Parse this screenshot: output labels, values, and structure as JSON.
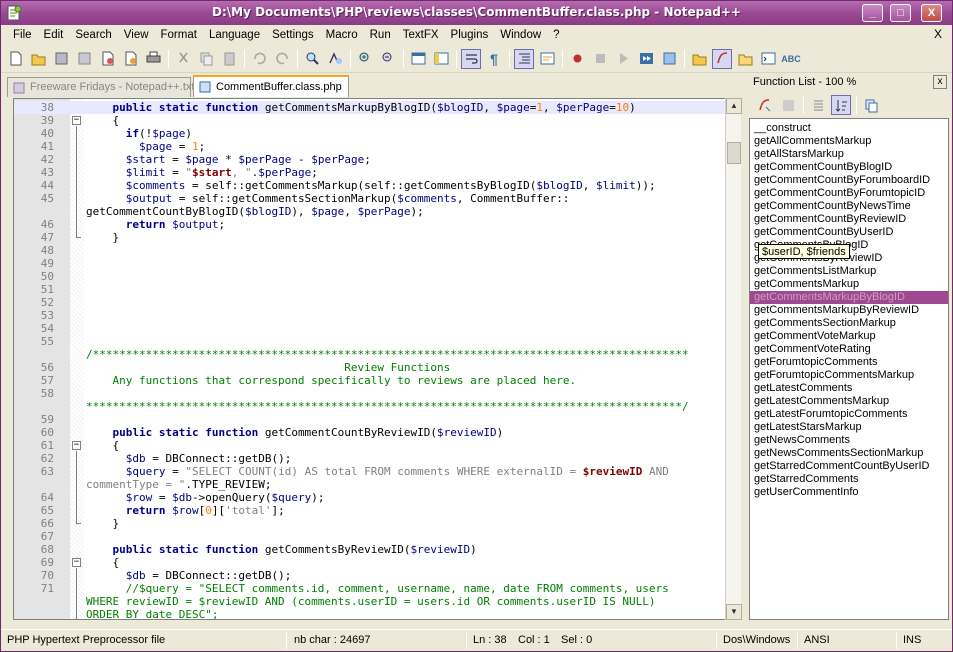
{
  "window": {
    "title": "D:\\My Documents\\PHP\\reviews\\classes\\CommentBuffer.class.php - Notepad++",
    "min": "_",
    "max": "□",
    "close": "X"
  },
  "menu": [
    "File",
    "Edit",
    "Search",
    "View",
    "Format",
    "Language",
    "Settings",
    "Macro",
    "Run",
    "TextFX",
    "Plugins",
    "Window",
    "?"
  ],
  "menu_close": "X",
  "tabs": [
    {
      "label": "Freeware Fridays - Notepad++.txt",
      "active": false
    },
    {
      "label": "CommentBuffer.class.php",
      "active": true
    }
  ],
  "code_lines": [
    {
      "n": "38",
      "fold": "",
      "hl": true,
      "html": "    <span class='kw'>public static function</span> getCommentsMarkupByBlogID(<span class='var'>$blogID</span>, <span class='var'>$page</span>=<span class='num-c'>1</span>, <span class='var'>$perPage</span>=<span class='num-c'>10</span>)"
    },
    {
      "n": "39",
      "fold": "box",
      "html": "    {"
    },
    {
      "n": "40",
      "fold": "",
      "html": "      <span class='kw'>if</span>(!<span class='var'>$page</span>)"
    },
    {
      "n": "41",
      "fold": "",
      "html": "        <span class='var'>$page</span> = <span class='num-c'>1</span>;"
    },
    {
      "n": "42",
      "fold": "",
      "html": "      <span class='var'>$start</span> = <span class='var'>$page</span> * <span class='var'>$perPage</span> - <span class='var'>$perPage</span>;"
    },
    {
      "n": "43",
      "fold": "",
      "html": "      <span class='var'>$limit</span> = <span class='str'>\"</span><span class='strv'>$start</span><span class='str'>, \"</span>.<span class='var'>$perPage</span>;"
    },
    {
      "n": "44",
      "fold": "",
      "html": "      <span class='var'>$comments</span> = self::getCommentsMarkup(self::getCommentsByBlogID(<span class='var'>$blogID</span>, <span class='var'>$limit</span>));"
    },
    {
      "n": "45",
      "fold": "",
      "html": "      <span class='var'>$output</span> = self::getCommentsSectionMarkup(<span class='var'>$comments</span>, CommentBuffer::"
    },
    {
      "n": "",
      "fold": "",
      "wrap": true,
      "html": "getCommentCountByBlogID(<span class='var'>$blogID</span>), <span class='var'>$page</span>, <span class='var'>$perPage</span>);"
    },
    {
      "n": "46",
      "fold": "",
      "html": "      <span class='kw'>return</span> <span class='var'>$output</span>;"
    },
    {
      "n": "47",
      "fold": "end",
      "html": "    }"
    },
    {
      "n": "48",
      "fold": "",
      "html": ""
    },
    {
      "n": "49",
      "fold": "",
      "html": ""
    },
    {
      "n": "50",
      "fold": "",
      "html": ""
    },
    {
      "n": "51",
      "fold": "",
      "html": ""
    },
    {
      "n": "52",
      "fold": "",
      "html": ""
    },
    {
      "n": "53",
      "fold": "",
      "html": ""
    },
    {
      "n": "54",
      "fold": "",
      "html": ""
    },
    {
      "n": "55",
      "fold": "",
      "html": ""
    },
    {
      "n": "",
      "fold": "",
      "wrap": true,
      "html": "<span class='cmt'>/******************************************************************************************</span>"
    },
    {
      "n": "56",
      "fold": "",
      "html": "<span class='cmt'>                                       Review Functions</span>"
    },
    {
      "n": "57",
      "fold": "",
      "html": "<span class='cmt'>    Any functions that correspond specifically to reviews are placed here.</span>"
    },
    {
      "n": "58",
      "fold": "",
      "html": ""
    },
    {
      "n": "",
      "fold": "",
      "wrap": true,
      "html": "<span class='cmt'>******************************************************************************************/</span>"
    },
    {
      "n": "59",
      "fold": "",
      "html": ""
    },
    {
      "n": "60",
      "fold": "",
      "html": "    <span class='kw'>public static function</span> getCommentCountByReviewID(<span class='var'>$reviewID</span>)"
    },
    {
      "n": "61",
      "fold": "box",
      "html": "    {"
    },
    {
      "n": "62",
      "fold": "",
      "html": "      <span class='var'>$db</span> = DBConnect::getDB();"
    },
    {
      "n": "63",
      "fold": "",
      "html": "      <span class='var'>$query</span> = <span class='str'>\"SELECT COUNT(id) AS total FROM comments WHERE externalID = </span><span class='strv'>$reviewID</span><span class='str'> AND</span>"
    },
    {
      "n": "",
      "fold": "",
      "wrap": true,
      "html": "<span class='str'>commentType = \"</span>.TYPE_REVIEW;"
    },
    {
      "n": "64",
      "fold": "",
      "html": "      <span class='var'>$row</span> = <span class='var'>$db</span>-&gt;openQuery(<span class='var'>$query</span>);"
    },
    {
      "n": "65",
      "fold": "",
      "html": "      <span class='kw'>return</span> <span class='var'>$row</span>[<span class='num-c'>0</span>][<span class='str'>'total'</span>];"
    },
    {
      "n": "66",
      "fold": "end",
      "html": "    }"
    },
    {
      "n": "67",
      "fold": "",
      "html": ""
    },
    {
      "n": "68",
      "fold": "",
      "html": "    <span class='kw'>public static function</span> getCommentsByReviewID(<span class='var'>$reviewID</span>)"
    },
    {
      "n": "69",
      "fold": "box",
      "html": "    {"
    },
    {
      "n": "70",
      "fold": "",
      "html": "      <span class='var'>$db</span> = DBConnect::getDB();"
    },
    {
      "n": "71",
      "fold": "",
      "html": "      <span class='cmt'>//$query = \"SELECT comments.id, comment, username, name, date FROM comments, users</span>"
    },
    {
      "n": "",
      "fold": "",
      "wrap": true,
      "html": "<span class='cmt'>WHERE reviewID = $reviewID AND (comments.userID = users.id OR comments.userID IS NULL)</span>"
    },
    {
      "n": "",
      "fold": "",
      "wrap": true,
      "html": "<span class='cmt'>ORDER BY date DESC\";</span>"
    }
  ],
  "function_list": {
    "header": "Function List - 100 %",
    "close": "x",
    "items": [
      "__construct",
      "getAllCommentsMarkup",
      "getAllStarsMarkup",
      "getCommentCountByBlogID",
      "getCommentCountByForumboardID",
      "getCommentCountByForumtopicID",
      "getCommentCountByNewsTime",
      "getCommentCountByReviewID",
      "getCommentCountByUserID",
      "getCommentsByBlogID",
      "getCommentsByReviewID",
      "getCommentsListMarkup",
      "getCommentsMarkup",
      "getCommentsMarkupByBlogID",
      "getCommentsMarkupByReviewID",
      "getCommentsSectionMarkup",
      "getCommentVoteMarkup",
      "getCommentVoteRating",
      "getForumtopicComments",
      "getForumtopicCommentsMarkup",
      "getLatestComments",
      "getLatestCommentsMarkup",
      "getLatestForumtopicComments",
      "getLatestStarsMarkup",
      "getNewsComments",
      "getNewsCommentsSectionMarkup",
      "getStarredCommentCountByUserID",
      "getStarredComments",
      "getUserCommentInfo"
    ],
    "selected_index": 13,
    "tooltip": "$userID, $friends"
  },
  "status": {
    "filetype": "PHP Hypertext Preprocessor file",
    "nbchar": "nb char : 24697",
    "ln": "Ln : 38",
    "col": "Col : 1",
    "sel": "Sel : 0",
    "eol": "Dos\\Windows",
    "encoding": "ANSI",
    "mode": "INS"
  }
}
